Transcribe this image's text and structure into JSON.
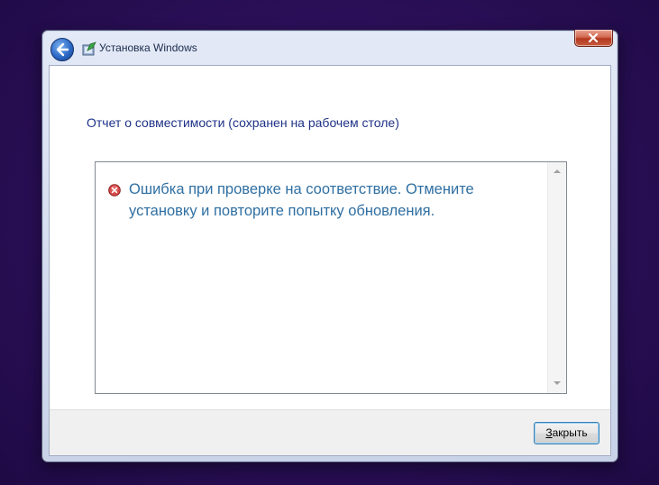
{
  "window": {
    "title": "Установка Windows",
    "close_tooltip_icon": "close-icon",
    "colors": {
      "accent": "#2c6ac7",
      "close": "#c75a3f"
    }
  },
  "main": {
    "heading": "Отчет о совместимости (сохранен на рабочем столе)",
    "report": {
      "icon": "error-icon",
      "message": "Ошибка при проверке на соответствие. Отмените установку и повторите попытку обновления.",
      "text_color": "#2f6fa2"
    }
  },
  "footer": {
    "close_button_label": "Закрыть"
  }
}
